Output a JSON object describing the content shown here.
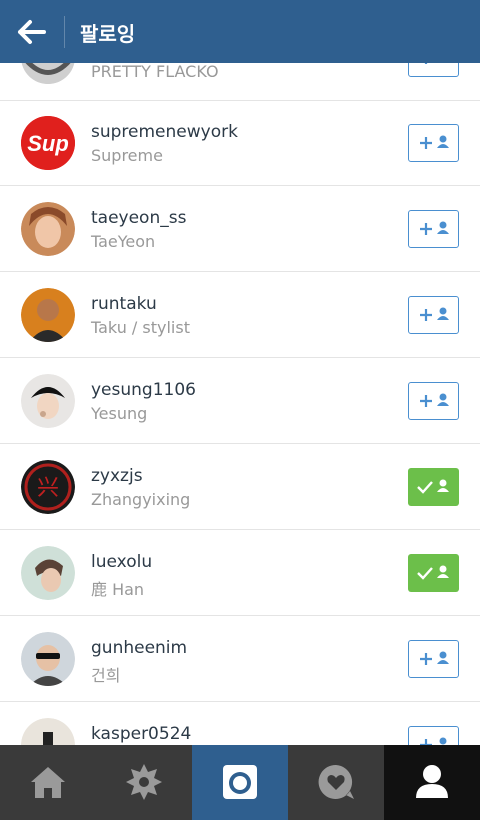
{
  "header": {
    "title": "팔로잉"
  },
  "list": {
    "partial_top": {
      "full_name": "PRETTY FLACKO"
    },
    "rows": [
      {
        "username": "supremenewyork",
        "full_name": "Supreme",
        "status": "follow"
      },
      {
        "username": "taeyeon_ss",
        "full_name": "TaeYeon",
        "status": "follow"
      },
      {
        "username": "runtaku",
        "full_name": "Taku / stylist",
        "status": "follow"
      },
      {
        "username": "yesung1106",
        "full_name": "Yesung",
        "status": "follow"
      },
      {
        "username": "zyxzjs",
        "full_name": "Zhangyixing",
        "status": "following"
      },
      {
        "username": "luexolu",
        "full_name": "鹿 Han",
        "status": "following"
      },
      {
        "username": "gunheenim",
        "full_name": "건희",
        "status": "follow"
      },
      {
        "username": "kasper0524",
        "full_name": "",
        "status": "follow"
      }
    ]
  },
  "avatars": {
    "supreme_text": "Sup",
    "zyx_text": "兴"
  },
  "colors": {
    "header": "#2f5f8f",
    "follow_border": "#4a8fd0",
    "following": "#6cbf4a",
    "bottom": "#3a3a3a",
    "tab_active": "#2f5f8f"
  },
  "bottom_nav": [
    "home-icon",
    "explore-icon",
    "camera-icon",
    "activity-icon",
    "profile-icon"
  ]
}
